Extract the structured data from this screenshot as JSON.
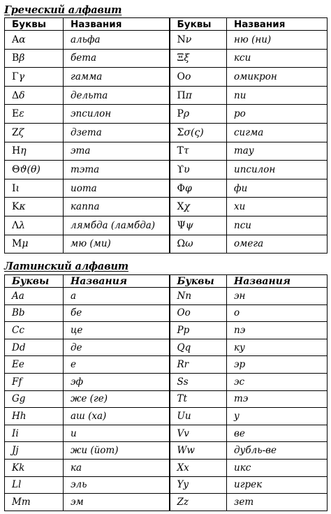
{
  "greek": {
    "title": "Греческий алфавит",
    "headers": [
      "Буквы",
      "Названия",
      "Буквы",
      "Названия"
    ],
    "rows": [
      {
        "left_letter": "Αα",
        "left_name": "альфа",
        "right_letter": "Νν",
        "right_name": "ню (ни)"
      },
      {
        "left_letter": "Ββ",
        "left_name": "бета",
        "right_letter": "Ξξ",
        "right_name": "кси"
      },
      {
        "left_letter": "Γγ",
        "left_name": "гамма",
        "right_letter": "Οο",
        "right_name": "омикрон"
      },
      {
        "left_letter": "Δδ",
        "left_name": "дельта",
        "right_letter": "Ππ",
        "right_name": "пи"
      },
      {
        "left_letter": "Εε",
        "left_name": "эпсилон",
        "right_letter": "Ρρ",
        "right_name": "ро"
      },
      {
        "left_letter": "Ζζ",
        "left_name": "дзета",
        "right_letter": "Σσ(ς)",
        "right_name": "сигма"
      },
      {
        "left_letter": "Ηη",
        "left_name": "эта",
        "right_letter": "Ττ",
        "right_name": "тау"
      },
      {
        "left_letter": "Θϑ(θ)",
        "left_name": "тэта",
        "right_letter": "ϒυ",
        "right_name": "ипсилон"
      },
      {
        "left_letter": "Ιι",
        "left_name": "иота",
        "right_letter": "Φφ",
        "right_name": "фи"
      },
      {
        "left_letter": "Κκ",
        "left_name": "каппа",
        "right_letter": "Χχ",
        "right_name": "хи"
      },
      {
        "left_letter": "Λλ",
        "left_name": "лямбда (ламбда)",
        "right_letter": "Ψψ",
        "right_name": "пси"
      },
      {
        "left_letter": "Μμ",
        "left_name": "мю (ми)",
        "right_letter": "Ωω",
        "right_name": "омега"
      }
    ]
  },
  "latin": {
    "title": "Латинский алфавит",
    "headers": [
      "Буквы",
      "Названия",
      "Буквы",
      "Названия"
    ],
    "rows": [
      {
        "left_letter": "Aa",
        "left_name": "а",
        "right_letter": "Nn",
        "right_name": "эн"
      },
      {
        "left_letter": "Bb",
        "left_name": "бе",
        "right_letter": "Oo",
        "right_name": "о"
      },
      {
        "left_letter": "Cc",
        "left_name": "це",
        "right_letter": "Pp",
        "right_name": "пэ"
      },
      {
        "left_letter": "Dd",
        "left_name": "де",
        "right_letter": "Qq",
        "right_name": "ку"
      },
      {
        "left_letter": "Ee",
        "left_name": "е",
        "right_letter": "Rr",
        "right_name": "эр"
      },
      {
        "left_letter": "Ff",
        "left_name": "эф",
        "right_letter": "Ss",
        "right_name": "эс"
      },
      {
        "left_letter": "Gg",
        "left_name": "же (ге)",
        "right_letter": "Tt",
        "right_name": "тэ"
      },
      {
        "left_letter": "Hh",
        "left_name": "аш (ха)",
        "right_letter": "Uu",
        "right_name": "у"
      },
      {
        "left_letter": "Ii",
        "left_name": "и",
        "right_letter": "Vv",
        "right_name": "ве"
      },
      {
        "left_letter": "Jj",
        "left_name": "жи (йот)",
        "right_letter": "Ww",
        "right_name": "дубль-ве"
      },
      {
        "left_letter": "Kk",
        "left_name": "ка",
        "right_letter": "Xx",
        "right_name": "икс"
      },
      {
        "left_letter": "Ll",
        "left_name": "эль",
        "right_letter": "Yy",
        "right_name": "игрек"
      },
      {
        "left_letter": "Mm",
        "left_name": "эм",
        "right_letter": "Zz",
        "right_name": "зет"
      }
    ]
  }
}
